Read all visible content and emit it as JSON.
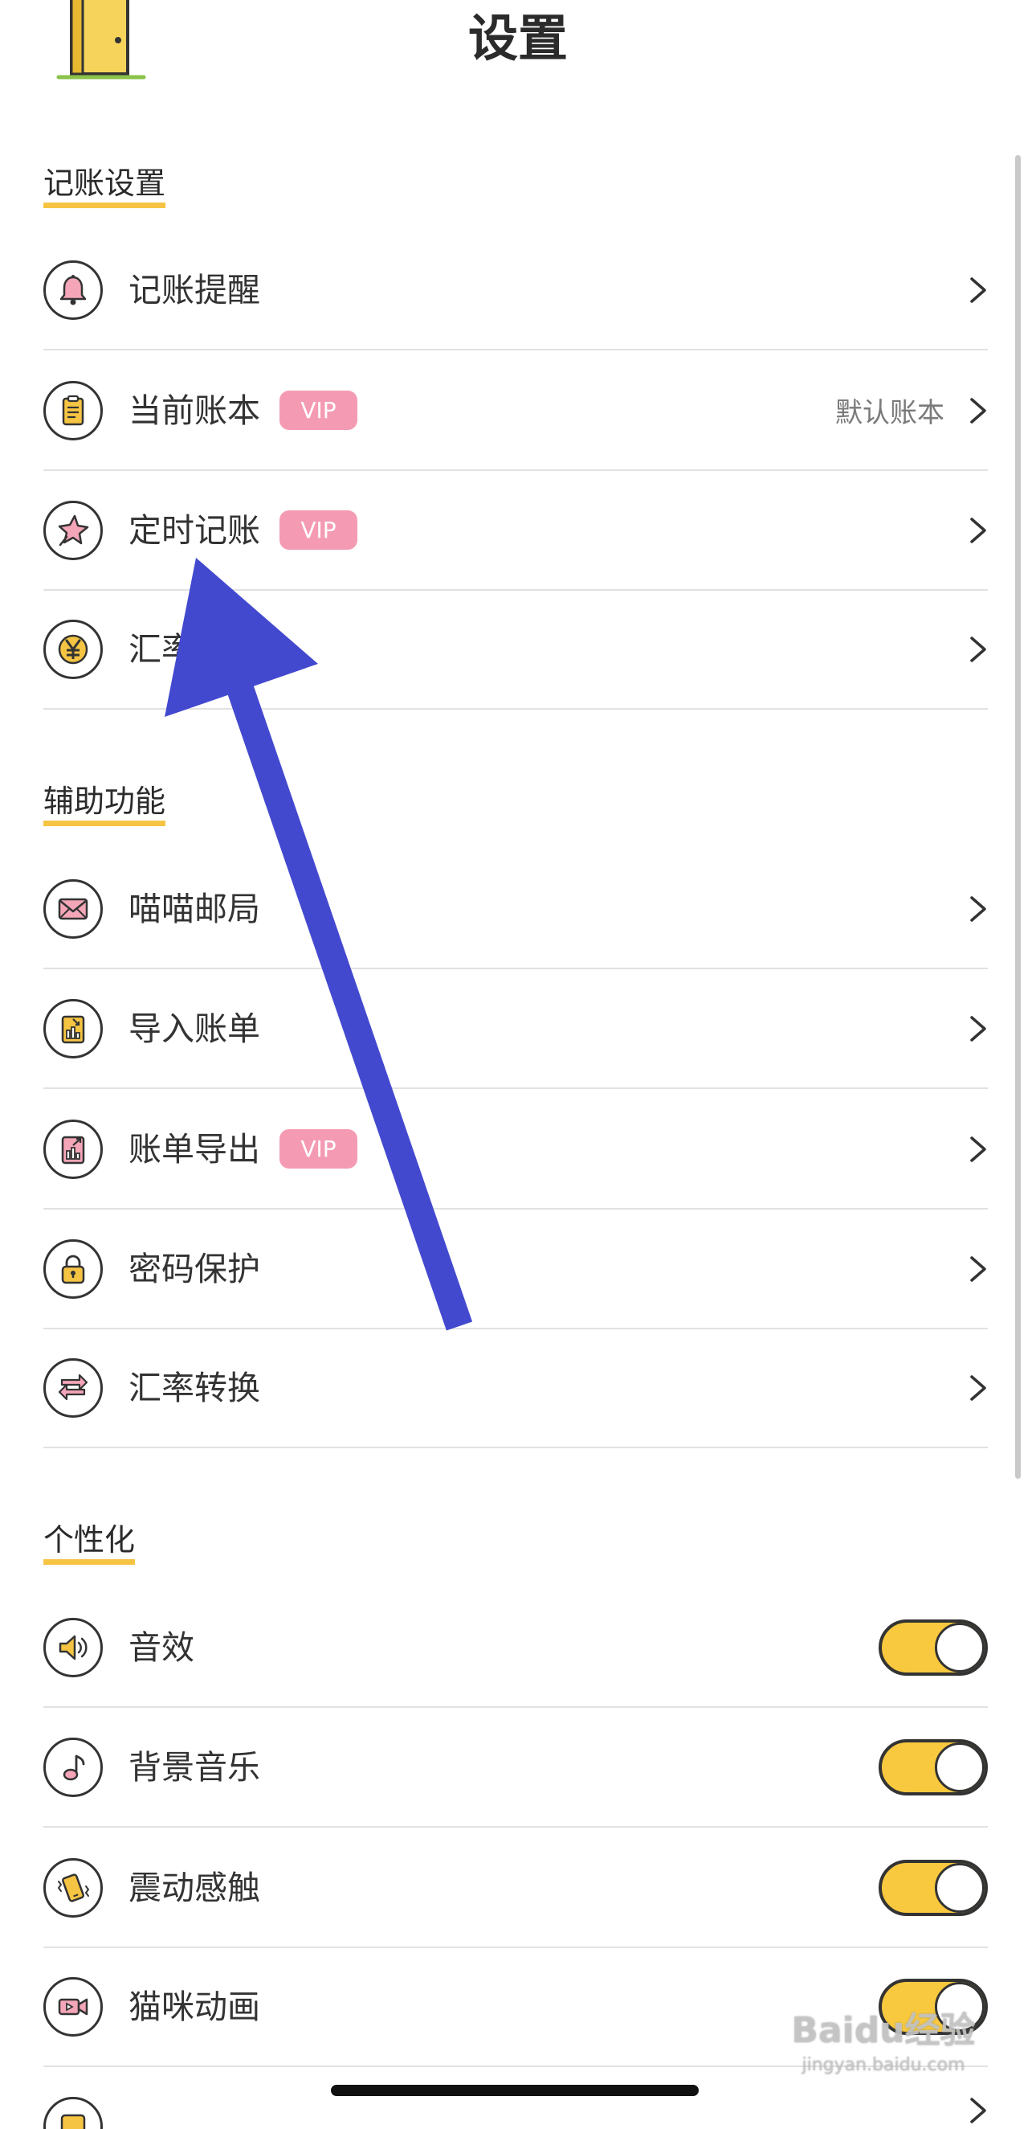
{
  "header": {
    "title": "设置"
  },
  "colors": {
    "accent_yellow": "#F6C443",
    "vip_pink": "#F49BB3",
    "arrow_blue": "#4349CF",
    "toggle_on": "#F8C93F",
    "text": "#333333"
  },
  "sections": [
    {
      "title": "记账设置",
      "items": [
        {
          "label": "记账提醒",
          "icon": "bell-icon"
        },
        {
          "label": "当前账本",
          "icon": "clipboard-icon",
          "badge": "VIP",
          "detail": "默认账本"
        },
        {
          "label": "定时记账",
          "icon": "pin-icon",
          "badge": "VIP"
        },
        {
          "label": "汇率",
          "icon": "yen-icon"
        }
      ]
    },
    {
      "title": "辅助功能",
      "items": [
        {
          "label": "喵喵邮局",
          "icon": "envelope-icon"
        },
        {
          "label": "导入账单",
          "icon": "import-chart-icon"
        },
        {
          "label": "账单导出",
          "icon": "export-chart-icon",
          "badge": "VIP"
        },
        {
          "label": "密码保护",
          "icon": "lock-icon"
        },
        {
          "label": "汇率转换",
          "icon": "exchange-arrows-icon"
        }
      ]
    },
    {
      "title": "个性化",
      "items": [
        {
          "label": "音效",
          "icon": "speaker-icon",
          "toggle_on": true
        },
        {
          "label": "背景音乐",
          "icon": "music-note-icon",
          "toggle_on": true
        },
        {
          "label": "震动感触",
          "icon": "phone-vibrate-icon",
          "toggle_on": true
        },
        {
          "label": "猫咪动画",
          "icon": "video-camera-icon",
          "toggle_on": true
        },
        {
          "icon": "widget-icon"
        }
      ]
    }
  ],
  "watermark": {
    "brand": "Baidu经验",
    "url": "jingyan.baidu.com"
  }
}
